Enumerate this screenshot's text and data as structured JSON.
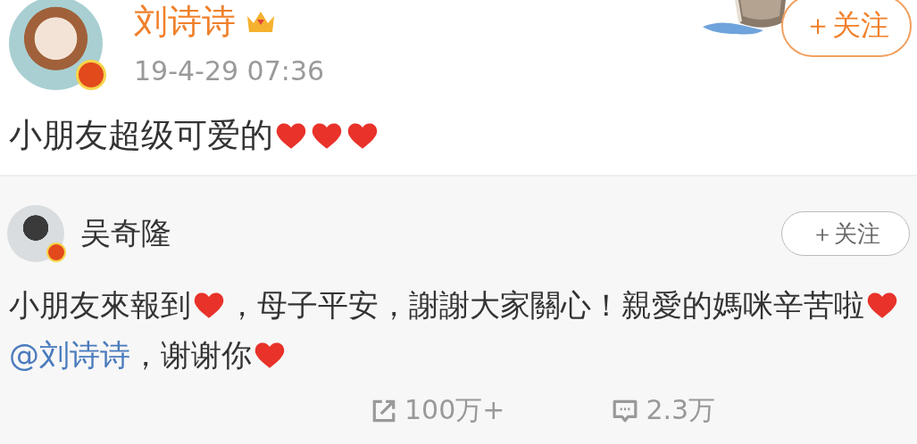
{
  "post": {
    "author": "刘诗诗",
    "verified": true,
    "time": "19-4-29 07:36",
    "follow_button": "＋关注",
    "content": [
      {
        "kind": "text",
        "text": "小朋友超级可爱的"
      },
      {
        "kind": "heart"
      },
      {
        "kind": "heart"
      },
      {
        "kind": "heart"
      }
    ]
  },
  "repost": {
    "author": "吴奇隆",
    "verified": true,
    "follow_button": "＋关注",
    "content": [
      {
        "kind": "text",
        "text": "小朋友來報到"
      },
      {
        "kind": "heart"
      },
      {
        "kind": "text",
        "text": "，母子平安，謝謝大家關心！親愛的媽咪辛苦啦"
      },
      {
        "kind": "heart"
      },
      {
        "kind": "mention",
        "text": " @刘诗诗"
      },
      {
        "kind": "text",
        "text": "，谢谢你"
      },
      {
        "kind": "heart"
      }
    ],
    "actions": [
      {
        "kind": "repost",
        "count": "100万+"
      },
      {
        "kind": "comment",
        "count": "2.3万"
      }
    ]
  }
}
